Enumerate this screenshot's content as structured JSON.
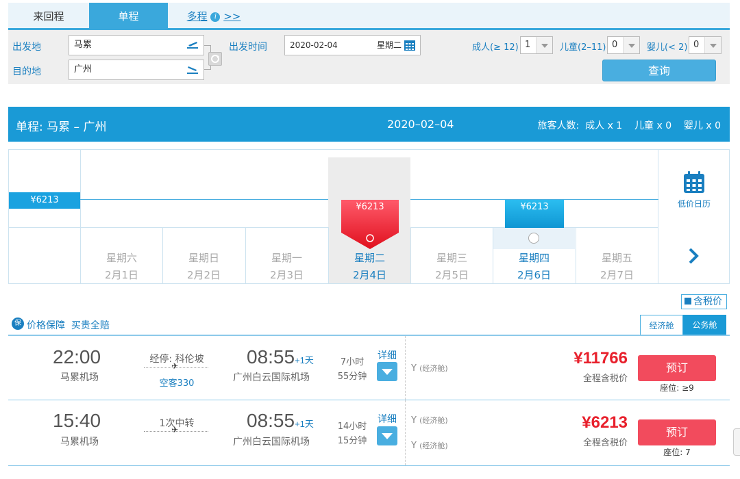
{
  "tabs": {
    "round_trip": "来回程",
    "one_way": "单程",
    "multi": "多程",
    "multi_more": ">>",
    "info": "i"
  },
  "form": {
    "from_label": "出发地",
    "from_value": "马累",
    "to_label": "目的地",
    "to_value": "广州",
    "date_label": "出发时间",
    "date_value": "2020-02-04",
    "date_weekday": "星期二",
    "adult_label": "成人(≥ 12)",
    "adult_value": "1",
    "child_label": "儿童(2–11)",
    "child_value": "0",
    "infant_label": "婴儿(< 2)",
    "infant_value": "0",
    "search_label": "查询"
  },
  "summary": {
    "route": "单程:  马累 – 广州",
    "date": "2020–02–04",
    "passengers": "旅客人数:  成人 x 1    儿童 x 0    婴儿 x 0"
  },
  "calendar": {
    "left_price": "¥6213",
    "low_price_label": "低价日历",
    "days": [
      {
        "weekday": "星期六",
        "date": "2月1日",
        "price": "",
        "state": "off"
      },
      {
        "weekday": "星期日",
        "date": "2月2日",
        "price": "",
        "state": "off"
      },
      {
        "weekday": "星期一",
        "date": "2月3日",
        "price": "",
        "state": "off"
      },
      {
        "weekday": "星期二",
        "date": "2月4日",
        "price": "¥6213",
        "state": "selected"
      },
      {
        "weekday": "星期三",
        "date": "2月5日",
        "price": "",
        "state": "off"
      },
      {
        "weekday": "星期四",
        "date": "2月6日",
        "price": "¥6213",
        "state": "available"
      },
      {
        "weekday": "星期五",
        "date": "2月7日",
        "price": "",
        "state": "off"
      }
    ]
  },
  "list_header": {
    "tax_label": "含税价",
    "guarantee_icon": "保",
    "guarantee": "价格保障  买贵全赔",
    "cabin_economy": "经济舱",
    "cabin_business": "公务舱"
  },
  "flights": [
    {
      "dep_time": "22:00",
      "dep_airport": "马累机场",
      "via": "经停: 科伦坡",
      "aircraft": "空客330",
      "arr_time": "08:55",
      "plus_day": "+1天",
      "arr_airport": "广州白云国际机场",
      "duration_1": "7小时",
      "duration_2": "55分钟",
      "detail": "详细",
      "cabins": [
        "Y",
        "(经济舱)"
      ],
      "price": "¥11766",
      "price_note": "全程含税价",
      "book": "预订",
      "seats": "座位:  ≥9"
    },
    {
      "dep_time": "15:40",
      "dep_airport": "马累机场",
      "via": "1次中转",
      "aircraft": "",
      "arr_time": "08:55",
      "plus_day": "+1天",
      "arr_airport": "广州白云国际机场",
      "duration_1": "14小时",
      "duration_2": "15分钟",
      "detail": "详细",
      "cabins": [
        "Y",
        "(经济舱)"
      ],
      "price": "¥6213",
      "price_note": "全程含税价",
      "book": "预订",
      "seats": "座位:  7"
    }
  ],
  "colors": {
    "accent": "#1a9ad6",
    "price_red": "#e8202c",
    "book_red": "#f24b5d"
  }
}
